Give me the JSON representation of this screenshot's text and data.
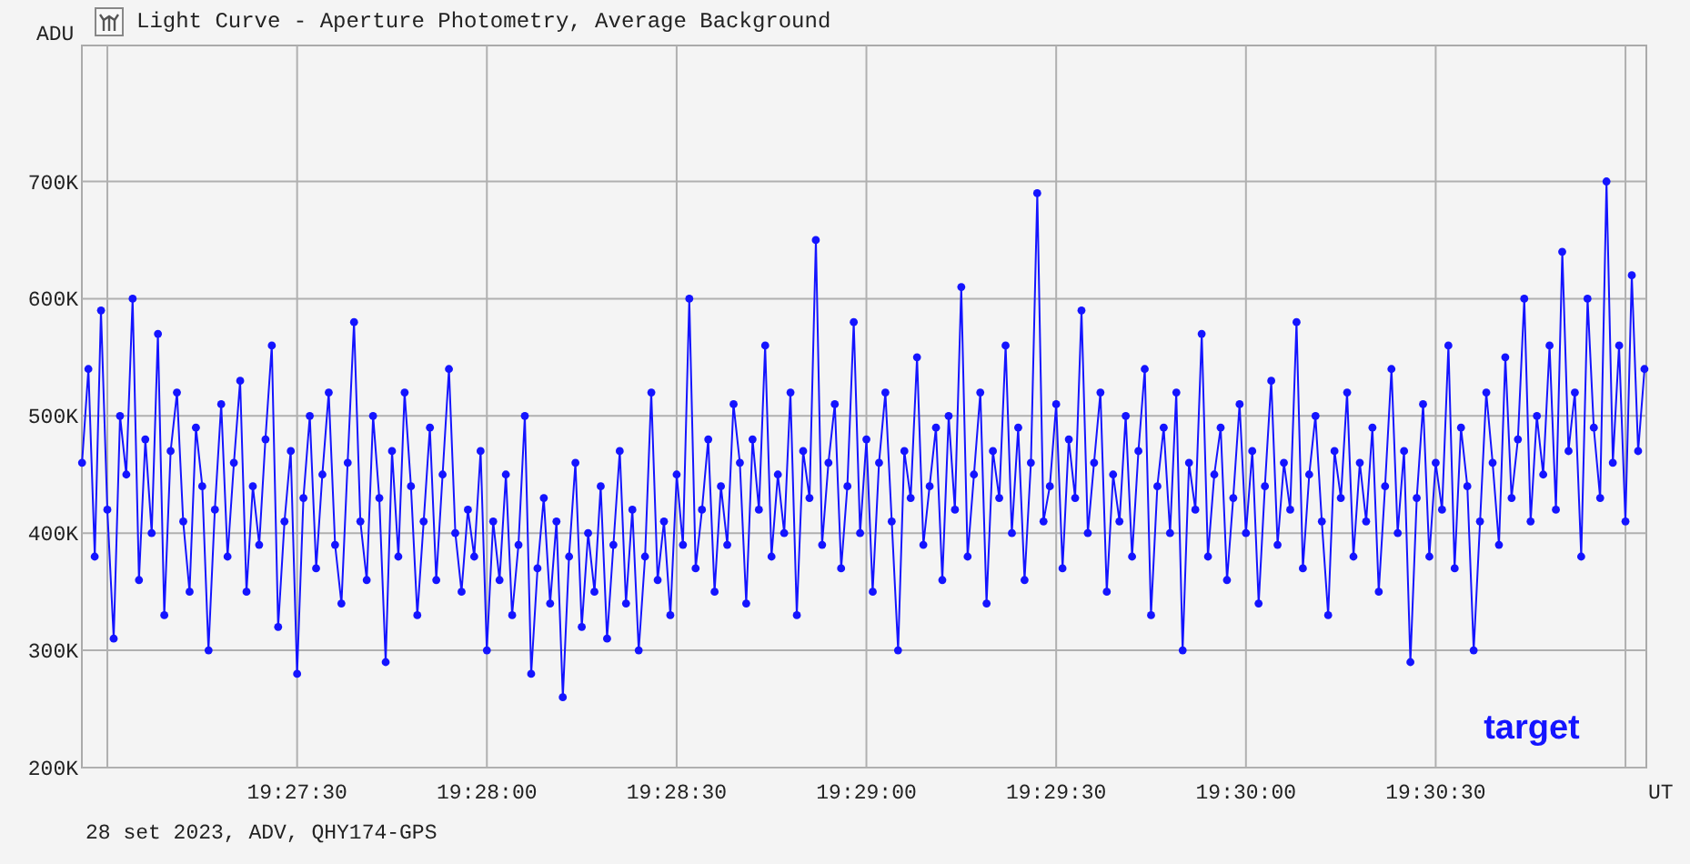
{
  "window": {
    "title": "Light Curve - Aperture Photometry, Average Background"
  },
  "chart": {
    "chart_data": {
      "type": "line",
      "grid": true,
      "xlabel": "UT",
      "ylabel": "ADU",
      "xlim": [
        70015.97,
        70263.3
      ],
      "ylim": [
        200,
        816
      ],
      "xticks": [
        {
          "value": 70050,
          "label": "19:27:30"
        },
        {
          "value": 70080,
          "label": "19:28:00"
        },
        {
          "value": 70110,
          "label": "19:28:30"
        },
        {
          "value": 70140,
          "label": "19:29:00"
        },
        {
          "value": 70170,
          "label": "19:29:30"
        },
        {
          "value": 70200,
          "label": "19:30:00"
        },
        {
          "value": 70230,
          "label": "19:30:30"
        }
      ],
      "yticks": [
        {
          "value": 700,
          "label": "700K"
        },
        {
          "value": 600,
          "label": "600K"
        },
        {
          "value": 500,
          "label": "500K"
        },
        {
          "value": 400,
          "label": "400K"
        },
        {
          "value": 300,
          "label": "300K"
        },
        {
          "value": 200,
          "label": "200K"
        }
      ],
      "x": [
        70016,
        70017,
        70018,
        70019,
        70020,
        70021,
        70022,
        70023,
        70024,
        70025,
        70026,
        70027,
        70028,
        70029,
        70030,
        70031,
        70032,
        70033,
        70034,
        70035,
        70036,
        70037,
        70038,
        70039,
        70040,
        70041,
        70042,
        70043,
        70044,
        70045,
        70046,
        70047,
        70048,
        70049,
        70050,
        70051,
        70052,
        70053,
        70054,
        70055,
        70056,
        70057,
        70058,
        70059,
        70060,
        70061,
        70062,
        70063,
        70064,
        70065,
        70066,
        70067,
        70068,
        70069,
        70070,
        70071,
        70072,
        70073,
        70074,
        70075,
        70076,
        70077,
        70078,
        70079,
        70080,
        70081,
        70082,
        70083,
        70084,
        70085,
        70086,
        70087,
        70088,
        70089,
        70090,
        70091,
        70092,
        70093,
        70094,
        70095,
        70096,
        70097,
        70098,
        70099,
        70100,
        70101,
        70102,
        70103,
        70104,
        70105,
        70106,
        70107,
        70108,
        70109,
        70110,
        70111,
        70112,
        70113,
        70114,
        70115,
        70116,
        70117,
        70118,
        70119,
        70120,
        70121,
        70122,
        70123,
        70124,
        70125,
        70126,
        70127,
        70128,
        70129,
        70130,
        70131,
        70132,
        70133,
        70134,
        70135,
        70136,
        70137,
        70138,
        70139,
        70140,
        70141,
        70142,
        70143,
        70144,
        70145,
        70146,
        70147,
        70148,
        70149,
        70150,
        70151,
        70152,
        70153,
        70154,
        70155,
        70156,
        70157,
        70158,
        70159,
        70160,
        70161,
        70162,
        70163,
        70164,
        70165,
        70166,
        70167,
        70168,
        70169,
        70170,
        70171,
        70172,
        70173,
        70174,
        70175,
        70176,
        70177,
        70178,
        70179,
        70180,
        70181,
        70182,
        70183,
        70184,
        70185,
        70186,
        70187,
        70188,
        70189,
        70190,
        70191,
        70192,
        70193,
        70194,
        70195,
        70196,
        70197,
        70198,
        70199,
        70200,
        70201,
        70202,
        70203,
        70204,
        70205,
        70206,
        70207,
        70208,
        70209,
        70210,
        70211,
        70212,
        70213,
        70214,
        70215,
        70216,
        70217,
        70218,
        70219,
        70220,
        70221,
        70222,
        70223,
        70224,
        70225,
        70226,
        70227,
        70228,
        70229,
        70230,
        70231,
        70232,
        70233,
        70234,
        70235,
        70236,
        70237,
        70238,
        70239,
        70240,
        70241,
        70242,
        70243,
        70244,
        70245,
        70246,
        70247,
        70248,
        70249,
        70250,
        70251,
        70252,
        70253,
        70254,
        70255,
        70256,
        70257,
        70258,
        70259,
        70260,
        70261,
        70262,
        70263
      ],
      "series": [
        {
          "name": "target",
          "color": "#1414ff",
          "marker": "circle",
          "values": [
            460,
            540,
            380,
            590,
            420,
            310,
            500,
            450,
            600,
            360,
            480,
            400,
            570,
            330,
            470,
            520,
            410,
            350,
            490,
            440,
            300,
            420,
            510,
            380,
            460,
            530,
            350,
            440,
            390,
            480,
            560,
            320,
            410,
            470,
            280,
            430,
            500,
            370,
            450,
            520,
            390,
            340,
            460,
            580,
            410,
            360,
            500,
            430,
            290,
            470,
            380,
            520,
            440,
            330,
            410,
            490,
            360,
            450,
            540,
            400,
            350,
            420,
            380,
            470,
            300,
            410,
            360,
            450,
            330,
            390,
            500,
            280,
            370,
            430,
            340,
            410,
            260,
            380,
            460,
            320,
            400,
            350,
            440,
            310,
            390,
            470,
            340,
            420,
            300,
            380,
            520,
            360,
            410,
            330,
            450,
            390,
            600,
            370,
            420,
            480,
            350,
            440,
            390,
            510,
            460,
            340,
            480,
            420,
            560,
            380,
            450,
            400,
            520,
            330,
            470,
            430,
            650,
            390,
            460,
            510,
            370,
            440,
            580,
            400,
            480,
            350,
            460,
            520,
            410,
            300,
            470,
            430,
            550,
            390,
            440,
            490,
            360,
            500,
            420,
            610,
            380,
            450,
            520,
            340,
            470,
            430,
            560,
            400,
            490,
            360,
            460,
            690,
            410,
            440,
            510,
            370,
            480,
            430,
            590,
            400,
            460,
            520,
            350,
            450,
            410,
            500,
            380,
            470,
            540,
            330,
            440,
            490,
            400,
            520,
            300,
            460,
            420,
            570,
            380,
            450,
            490,
            360,
            430,
            510,
            400,
            470,
            340,
            440,
            530,
            390,
            460,
            420,
            580,
            370,
            450,
            500,
            410,
            330,
            470,
            430,
            520,
            380,
            460,
            410,
            490,
            350,
            440,
            540,
            400,
            470,
            290,
            430,
            510,
            380,
            460,
            420,
            560,
            370,
            490,
            440,
            300,
            410,
            520,
            460,
            390,
            550,
            430,
            480,
            600,
            410,
            500,
            450,
            560,
            420,
            640,
            470,
            520,
            380,
            600,
            490,
            430,
            700,
            460,
            560,
            410,
            620,
            470,
            540
          ]
        }
      ]
    }
  },
  "footer": "28 set 2023, ADV, QHY174-GPS"
}
